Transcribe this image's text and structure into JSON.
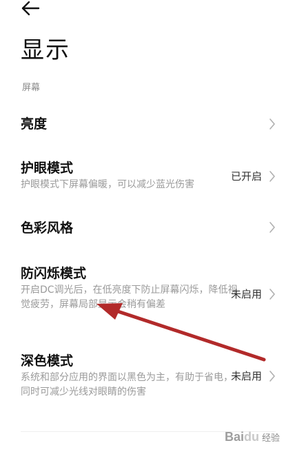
{
  "header": {
    "back_icon": "back-arrow-icon",
    "title": "显示"
  },
  "section": {
    "label": "屏幕"
  },
  "rows": [
    {
      "title": "亮度",
      "description": "",
      "status": ""
    },
    {
      "title": "护眼模式",
      "description": "护眼模式下屏幕偏暖，可以减少蓝光伤害",
      "status": "已开启"
    },
    {
      "title": "色彩风格",
      "description": "",
      "status": ""
    },
    {
      "title": "防闪烁模式",
      "description": "开启DC调光后，在低亮度下防止屏幕闪烁，降低视觉疲劳，屏幕局部显示会稍有偏差",
      "status": "未启用"
    },
    {
      "title": "深色模式",
      "description": "系统和部分应用的界面以黑色为主，有助于省电，同时可减少光线对眼睛的伤害",
      "status": "未启用"
    }
  ],
  "annotation": {
    "arrow_color": "#b22a2a"
  },
  "watermark": {
    "brand_text": "Bai",
    "brand_suffix": "du",
    "site_text": "经验"
  }
}
